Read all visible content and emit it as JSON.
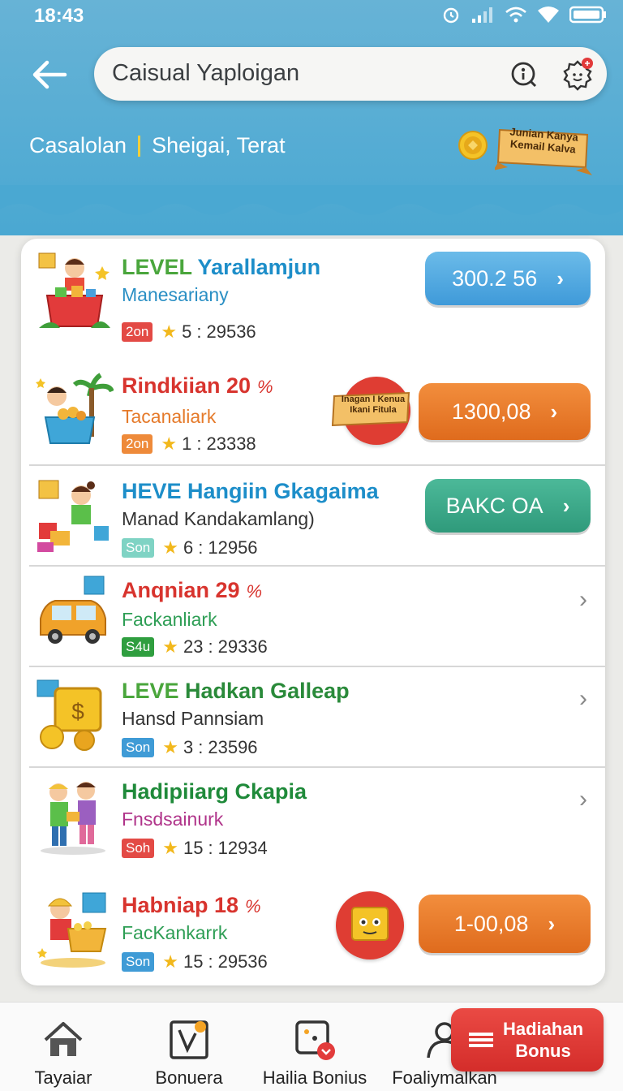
{
  "status_bar": {
    "time": "18:43"
  },
  "header": {
    "search_text": "Caisual Yaploigan",
    "sub_left": "Casalolan",
    "sub_right": "Sheigai, Terat",
    "banner_text": "Junian Kanya Kemail Kalva"
  },
  "colors": {
    "header_blue": "#4aa8d2",
    "orange": "#e57a2a",
    "blue": "#4aa0dc",
    "green": "#36a585",
    "red": "#d8342e"
  },
  "rows": [
    {
      "title_level": "LEVEL",
      "title_rest": "Yarallamjun",
      "subtitle": "Manesariany",
      "badge": "2on",
      "rating": "5",
      "score": "29536",
      "action": "300.2 56",
      "illustration": "shopping-basket-girl"
    },
    {
      "title": "Rindkiian 20",
      "pct": "%",
      "subtitle": "Tacanaliark",
      "badge": "2on",
      "rating": "1",
      "score": "23338",
      "promo": "Inagan I Kenua Ikani Fitula",
      "action": "1300,08",
      "illustration": "boy-with-palm-basket"
    },
    {
      "title": "HEVE Hangiin Gkagaima",
      "subtitle": "Manad Kandakamlang)",
      "badge": "Son",
      "rating": "6",
      "score": "12956",
      "action": "BAKC OA",
      "illustration": "girl-with-gifts"
    },
    {
      "title": "Anqnian 29",
      "pct": "%",
      "subtitle": "Fackanliark",
      "badge": "S4u",
      "rating": "23",
      "score": "29336",
      "illustration": "car"
    },
    {
      "title_level": "LEVE",
      "title_rest": "Hadkan Galleap",
      "subtitle": "Hansd Pannsiam",
      "badge": "Son",
      "rating": "3",
      "score": "23596",
      "illustration": "coin-box"
    },
    {
      "title": "Hadipiiarg Ckapia",
      "subtitle": "Fnsdsainurk",
      "badge": "Sоh",
      "rating": "15",
      "score": "12934",
      "illustration": "two-kids"
    },
    {
      "title": "Habniap 18",
      "pct": "%",
      "subtitle": "FacKankarrk",
      "badge": "Son",
      "rating": "15",
      "score": "29536",
      "action": "1-00,08",
      "illustration": "kid-with-treasure"
    }
  ],
  "bottom_nav": [
    {
      "label": "Tayaiar",
      "icon": "home-icon"
    },
    {
      "label": "Bonuera",
      "icon": "edit-icon"
    },
    {
      "label": "Hailia Bonius",
      "icon": "bonus-icon"
    },
    {
      "label": "Foaliymalkan",
      "icon": "profile-icon"
    }
  ],
  "bonus_button": {
    "line1": "Hadiahan",
    "line2": "Bonus"
  }
}
